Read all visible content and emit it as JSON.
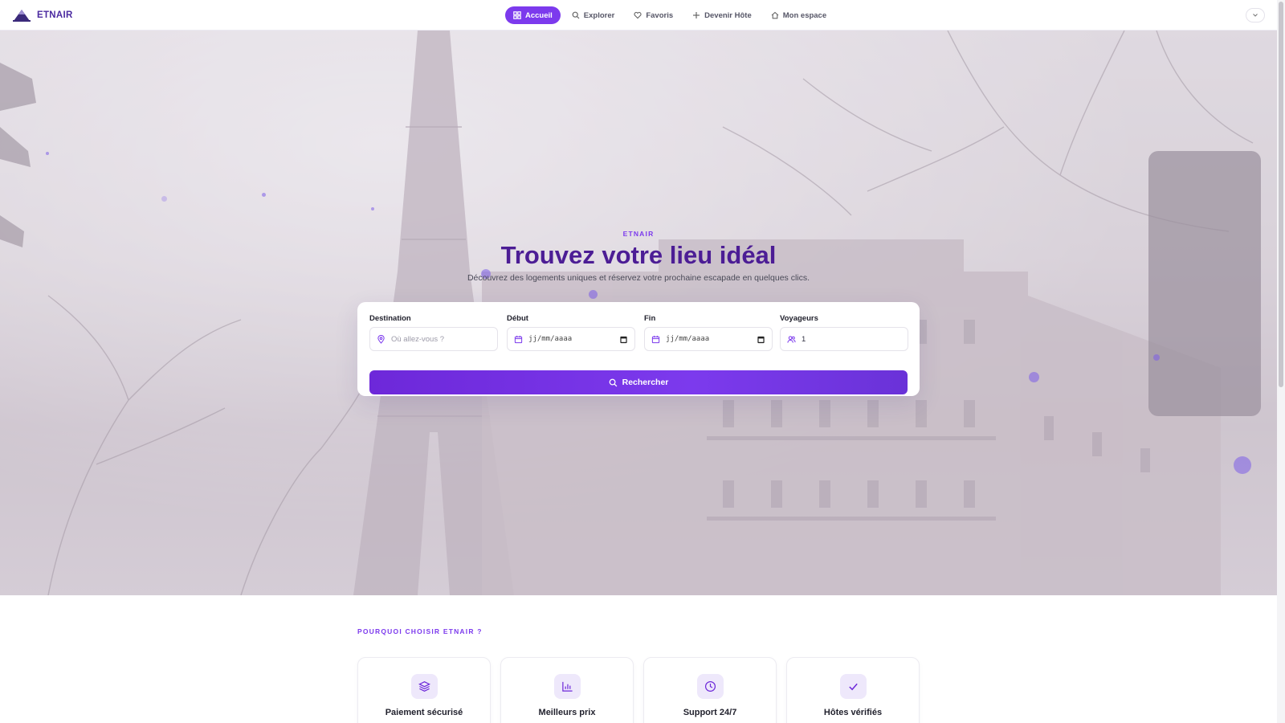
{
  "header": {
    "logo_text": "ETNAIR",
    "nav": [
      {
        "label": "Accueil",
        "icon": "grid-icon",
        "active": true
      },
      {
        "label": "Explorer",
        "icon": "search-icon",
        "active": false
      },
      {
        "label": "Favoris",
        "icon": "heart-icon",
        "active": false
      },
      {
        "label": "Devenir Hôte",
        "icon": "plus-icon",
        "active": false
      },
      {
        "label": "Mon espace",
        "icon": "home-icon",
        "active": false
      }
    ]
  },
  "hero": {
    "eyebrow": "ETNAIR",
    "title": "Trouvez votre lieu idéal",
    "subtitle": "Découvrez des logements uniques et réservez votre prochaine escapade en quelques clics."
  },
  "search": {
    "destination": {
      "label": "Destination",
      "placeholder": "Où allez-vous ?"
    },
    "start": {
      "label": "Début",
      "value": "jj/mm/aaaa"
    },
    "end": {
      "label": "Fin",
      "value": "jj/mm/aaaa"
    },
    "guests": {
      "label": "Voyageurs",
      "value": "1"
    },
    "button_label": "Rechercher"
  },
  "features": {
    "eyebrow": "POURQUOI CHOISIR ETNAIR ?",
    "cards": [
      {
        "title": "Paiement sécurisé",
        "icon": "layers-icon"
      },
      {
        "title": "Meilleurs prix",
        "icon": "chart-icon"
      },
      {
        "title": "Support 24/7",
        "icon": "clock-icon"
      },
      {
        "title": "Hôtes vérifiés",
        "icon": "check-icon"
      }
    ]
  },
  "colors": {
    "accent": "#7c3aed",
    "title": "#4c1d95",
    "logo": "#4b2aa0"
  }
}
